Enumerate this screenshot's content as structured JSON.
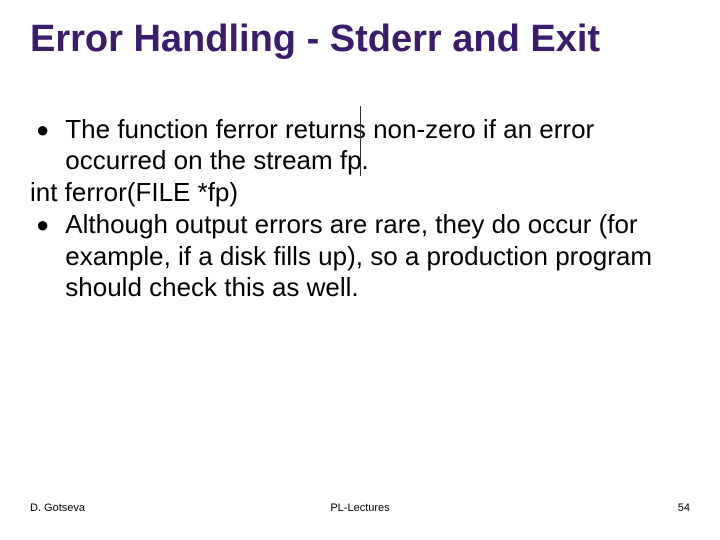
{
  "title": "Error Handling - Stderr and Exit",
  "bullets": {
    "b1": "The function ferror returns non-zero if an error occurred on the stream fp.",
    "line": "int ferror(FILE *fp)",
    "b2": "Although output errors are rare, they do occur (for example, if a disk fills up), so a production program should check this as well."
  },
  "footer": {
    "left": "D. Gotseva",
    "center": "PL-Lectures",
    "right": "54"
  }
}
